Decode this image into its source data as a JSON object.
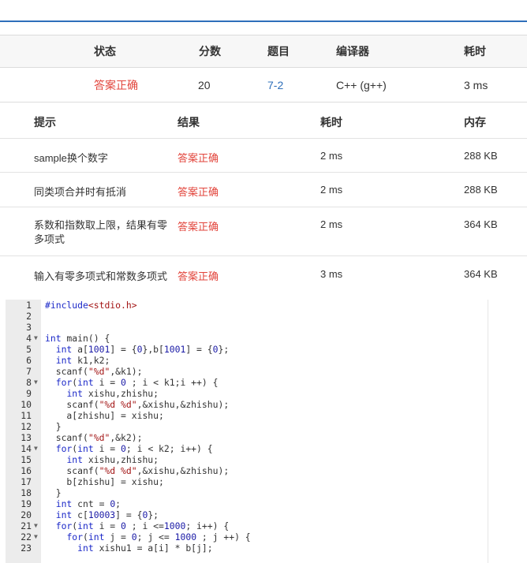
{
  "summary": {
    "headers": [
      "状态",
      "分数",
      "题目",
      "编译器",
      "耗时"
    ],
    "status": "答案正确",
    "score": "20",
    "problem": "7-2",
    "compiler": "C++ (g++)",
    "time": "3 ms"
  },
  "testcases": {
    "headers": [
      "提示",
      "结果",
      "耗时",
      "内存"
    ],
    "rows": [
      {
        "hint": "sample换个数字",
        "result": "答案正确",
        "time": "2 ms",
        "memory": "288 KB"
      },
      {
        "hint": "同类项合并时有抵消",
        "result": "答案正确",
        "time": "2 ms",
        "memory": "288 KB"
      },
      {
        "hint": "系数和指数取上限，结果有零多项式",
        "hint_line1": "系数和指数取上限，结果有零",
        "hint_line2": "多项式",
        "result": "答案正确",
        "time": "2 ms",
        "memory": "364 KB"
      },
      {
        "hint": "输入有零多项式和常数多项式",
        "result": "答案正确",
        "time": "3 ms",
        "memory": "364 KB"
      }
    ]
  },
  "code": {
    "lines": [
      "#include<stdio.h>",
      "",
      "",
      "int main() {",
      "  int a[1001] = {0},b[1001] = {0};",
      "  int k1,k2;",
      "  scanf(\"%d\",&k1);",
      "  for(int i = 0 ; i < k1;i ++) {",
      "    int xishu,zhishu;",
      "    scanf(\"%d %d\",&xishu,&zhishu);",
      "    a[zhishu] = xishu;",
      "  }",
      "  scanf(\"%d\",&k2);",
      "  for(int i = 0; i < k2; i++) {",
      "    int xishu,zhishu;",
      "    scanf(\"%d %d\",&xishu,&zhishu);",
      "    b[zhishu] = xishu;",
      "  }",
      "  int cnt = 0;",
      "  int c[10003] = {0};",
      "  for(int i = 0 ; i <=1000; i++) {",
      "    for(int j = 0; j <= 1000 ; j ++) {",
      "      int xishu1 = a[i] * b[j];"
    ],
    "fold_lines": [
      4,
      8,
      14,
      21,
      22
    ]
  },
  "colors": {
    "accent": "#2e6fba",
    "ok": "#e2453c",
    "header_bg": "#f7f7f7",
    "gutter_bg": "#ececec"
  }
}
